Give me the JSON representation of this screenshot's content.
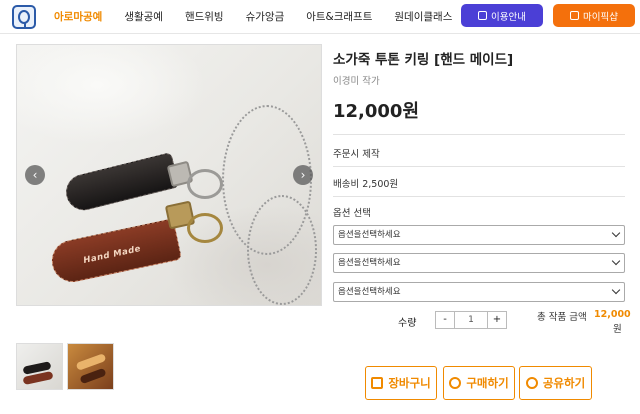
{
  "header": {
    "nav": [
      "아로마공예",
      "생활공예",
      "핸드위빙",
      "슈가앙금",
      "아트&크래프트",
      "원데이클래스"
    ],
    "info_button": "이용안내",
    "my_button": "마이픽샵"
  },
  "gallery": {
    "image_text": "Hand Made"
  },
  "product": {
    "title": "소가죽 투톤 키링 [핸드 메이드]",
    "author": "이경미 작가",
    "price": "12,000원",
    "made_to_order": "주문시 제작",
    "shipping": "배송비 2,500원",
    "option_label": "옵션 선택",
    "option_placeholders": [
      "옵션을선택하세요",
      "옵션을선택하세요",
      "옵션을선택하세요"
    ]
  },
  "purchase": {
    "qty_label": "수량",
    "minus": "-",
    "plus": "+",
    "qty_value": "1",
    "total_label": "총 작품 금액",
    "total_value": "12,000",
    "total_unit": "원",
    "cart": "장바구니",
    "buy": "구매하기",
    "share": "공유하기"
  }
}
